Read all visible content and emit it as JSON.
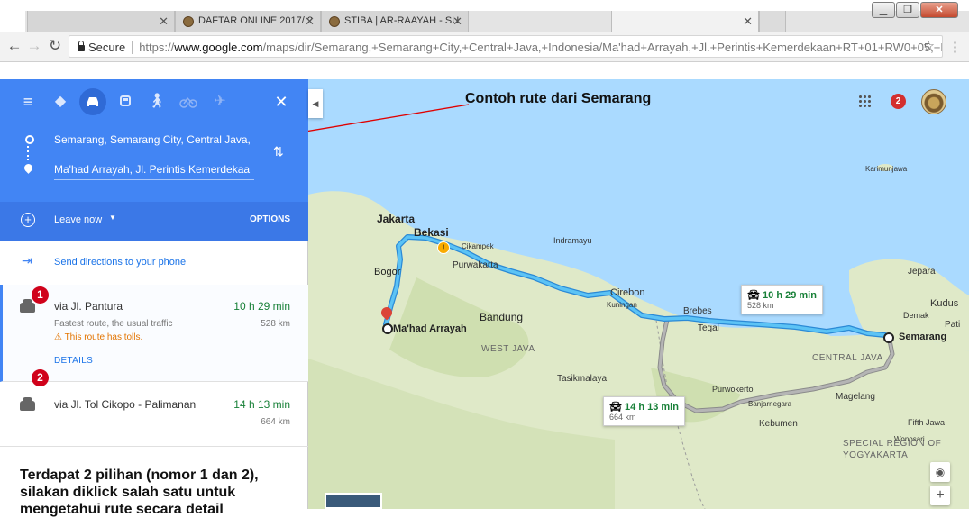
{
  "browser": {
    "tabs": [
      {
        "title": ""
      },
      {
        "title": "DAFTAR ONLINE 2017/ 2"
      },
      {
        "title": "STIBA | AR-RAAYAH - SU"
      },
      {
        "title": ""
      }
    ],
    "address": {
      "secure_label": "Secure",
      "url_scheme": "https://",
      "url_host": "www.google.com",
      "url_path": "/maps/dir/Semarang,+Semarang+City,+Central+Java,+Indonesia/Ma'had+Arrayah,+Jl.+Perintis+Kemerdekaan+RT+01+RW0+05,+Kp.+Cimenti"
    }
  },
  "directions": {
    "origin": "Semarang, Semarang City, Central Java,",
    "destination": "Ma'had Arrayah, Jl. Perintis Kemerdekaa",
    "leave_now": "Leave now",
    "options": "OPTIONS",
    "send_to_phone": "Send directions to your phone",
    "routes": [
      {
        "name": "via Jl. Pantura",
        "time": "10 h 29 min",
        "distance": "528 km",
        "subtitle": "Fastest route, the usual traffic",
        "warning": "This route has tolls.",
        "details": "DETAILS",
        "badge": "1"
      },
      {
        "name": "via Jl. Tol Cikopo - Palimanan",
        "time": "14 h 13 min",
        "distance": "664 km",
        "badge": "2"
      }
    ]
  },
  "annotation": {
    "panel_text": "Terdapat 2 pilihan (nomor 1 dan 2), silakan diklick salah satu untuk mengetahui rute secara detail",
    "callout": "Contoh rute dari Semarang"
  },
  "map": {
    "notification_count": "2",
    "labels": {
      "jakarta": "Jakarta",
      "bekasi": "Bekasi",
      "cikampek": "Cikampek",
      "indramayu": "Indramayu",
      "purwakarta": "Purwakarta",
      "bogor": "Bogor",
      "cirebon": "Cirebon",
      "kuningan": "Kuningan",
      "brebes": "Brebes",
      "tegal": "Tegal",
      "bandung": "Bandung",
      "west_java": "WEST JAVA",
      "tasikmalaya": "Tasikmalaya",
      "purwokerto": "Purwokerto",
      "banjarnegara": "Banjarnegara",
      "kebumen": "Kebumen",
      "magelang": "Magelang",
      "central_java": "CENTRAL JAVA",
      "semarang": "Semarang",
      "mahad": "Ma'had Arrayah",
      "jepara": "Jepara",
      "kudus": "Kudus",
      "demak": "Demak",
      "pati": "Pati",
      "karimunjawa": "Karimunjawa",
      "wonosari": "Wonosari",
      "fifth_jawa": "Fifth Jawa",
      "diy": "SPECIAL REGION OF YOGYAKARTA"
    },
    "route1_box": {
      "time": "10 h 29 min",
      "distance": "528 km"
    },
    "route2_box": {
      "time": "14 h 13 min",
      "distance": "664 km"
    }
  },
  "colors": {
    "accent": "#4285f4",
    "route_primary": "#4fb3f0",
    "route_alt": "#9e9e9e",
    "badge_red": "#d0021b",
    "time_green": "#188038"
  }
}
